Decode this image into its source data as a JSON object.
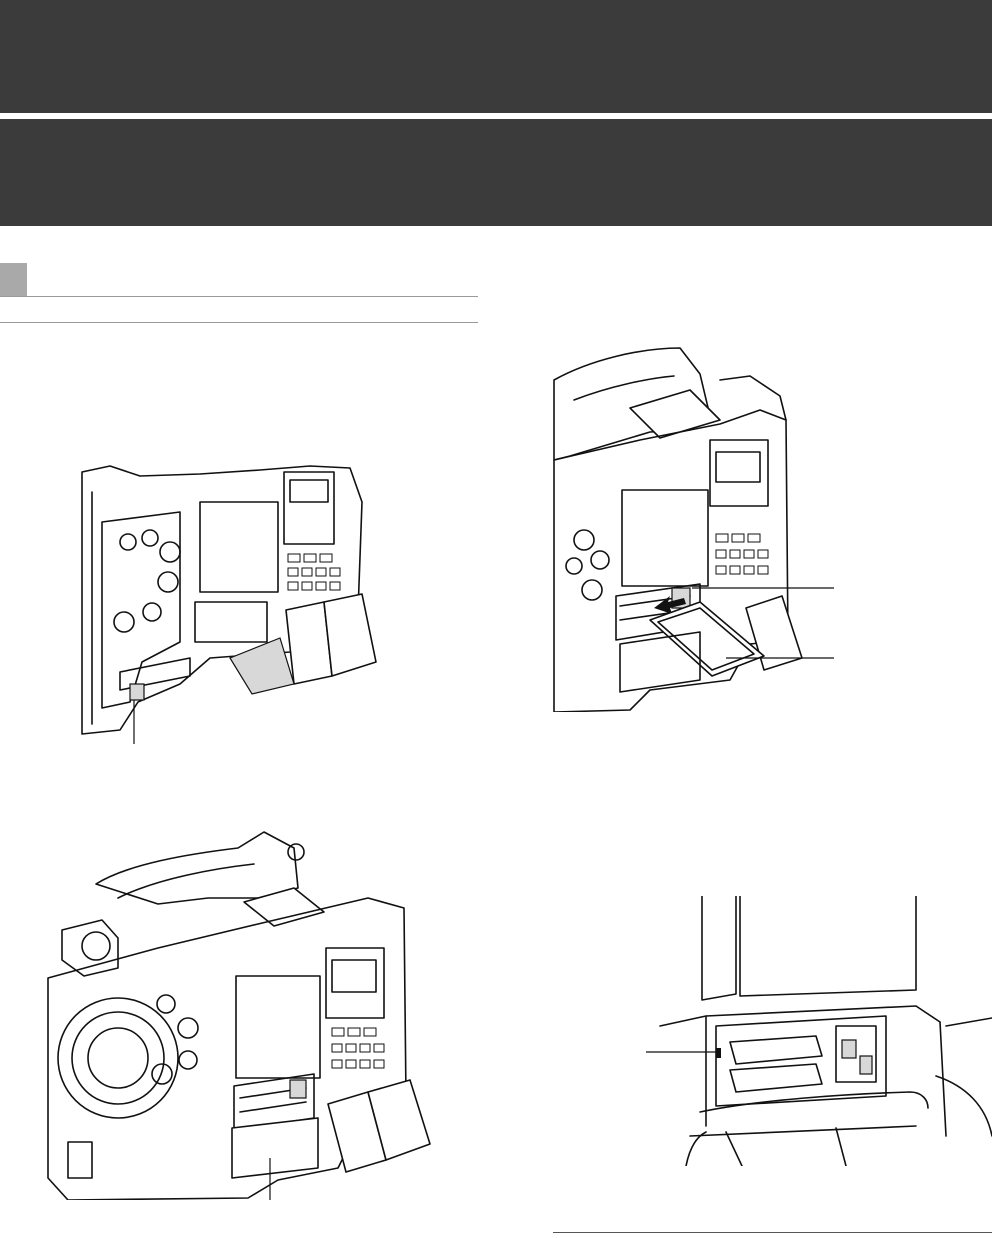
{
  "page": {
    "header_bands": [
      "",
      ""
    ],
    "section_number": ""
  },
  "figures": [
    {
      "id": "fig-1",
      "subject": "camera-side-panel-with-slot-cover-latch"
    },
    {
      "id": "fig-2",
      "subject": "inserting-p2-card-into-slot"
    },
    {
      "id": "fig-3",
      "subject": "camera-with-slot-cover-open"
    },
    {
      "id": "fig-4",
      "subject": "card-slot-access-led-closeup"
    }
  ],
  "colors": {
    "header_band": "#3b3b3b",
    "section_marker": "#a9a9a9",
    "rule": "#9a9a9a"
  }
}
